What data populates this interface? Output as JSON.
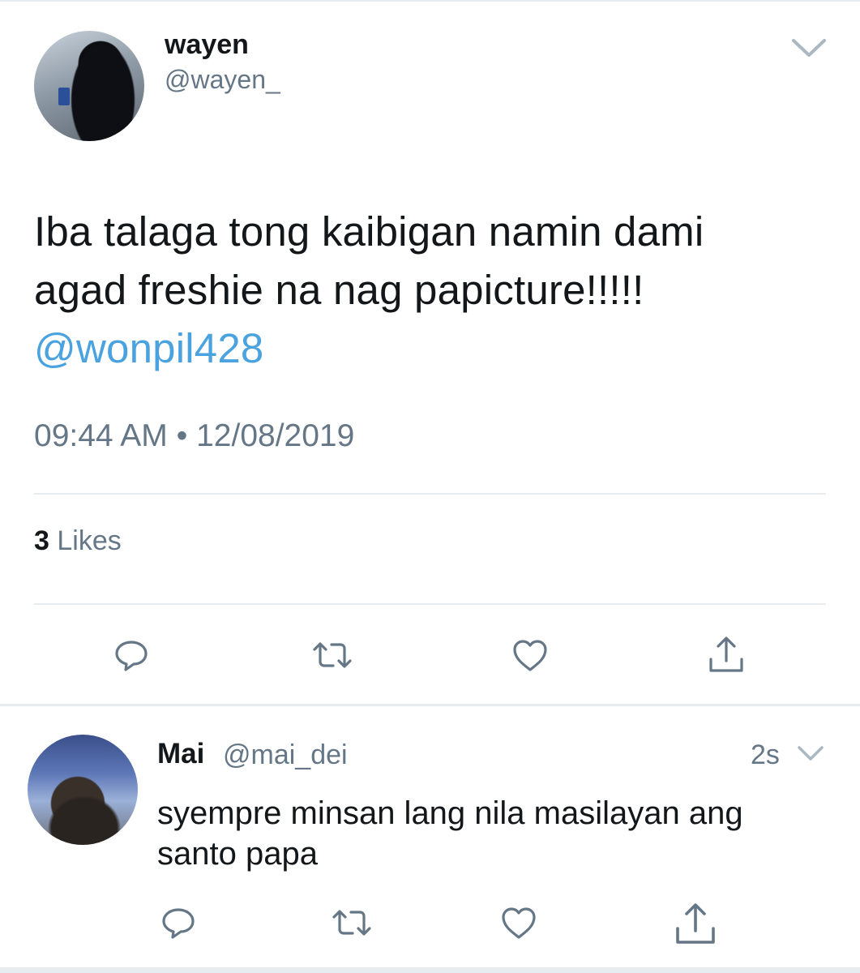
{
  "main_tweet": {
    "name": "wayen",
    "handle": "@wayen_",
    "text_line1": "Iba talaga tong kaibigan namin dami",
    "text_line2": "agad freshie na nag papicture!!!!!",
    "mention": "@wonpil428",
    "timestamp": "09:44 AM • 12/08/2019",
    "likes_count": "3",
    "likes_label": "Likes",
    "actions": [
      "reply-icon",
      "retweet-icon",
      "like-icon",
      "share-icon"
    ]
  },
  "reply": {
    "name": "Mai",
    "handle": "@mai_dei",
    "time": "2s",
    "text_line1": "syempre minsan lang nila masilayan ang",
    "text_line2": "santo papa",
    "actions": [
      "reply-icon",
      "retweet-icon",
      "like-icon",
      "share-icon"
    ]
  },
  "colors": {
    "link": "#4aa3df",
    "secondary_text": "#657786",
    "divider": "#e6ecf0",
    "icon": "#657786"
  }
}
